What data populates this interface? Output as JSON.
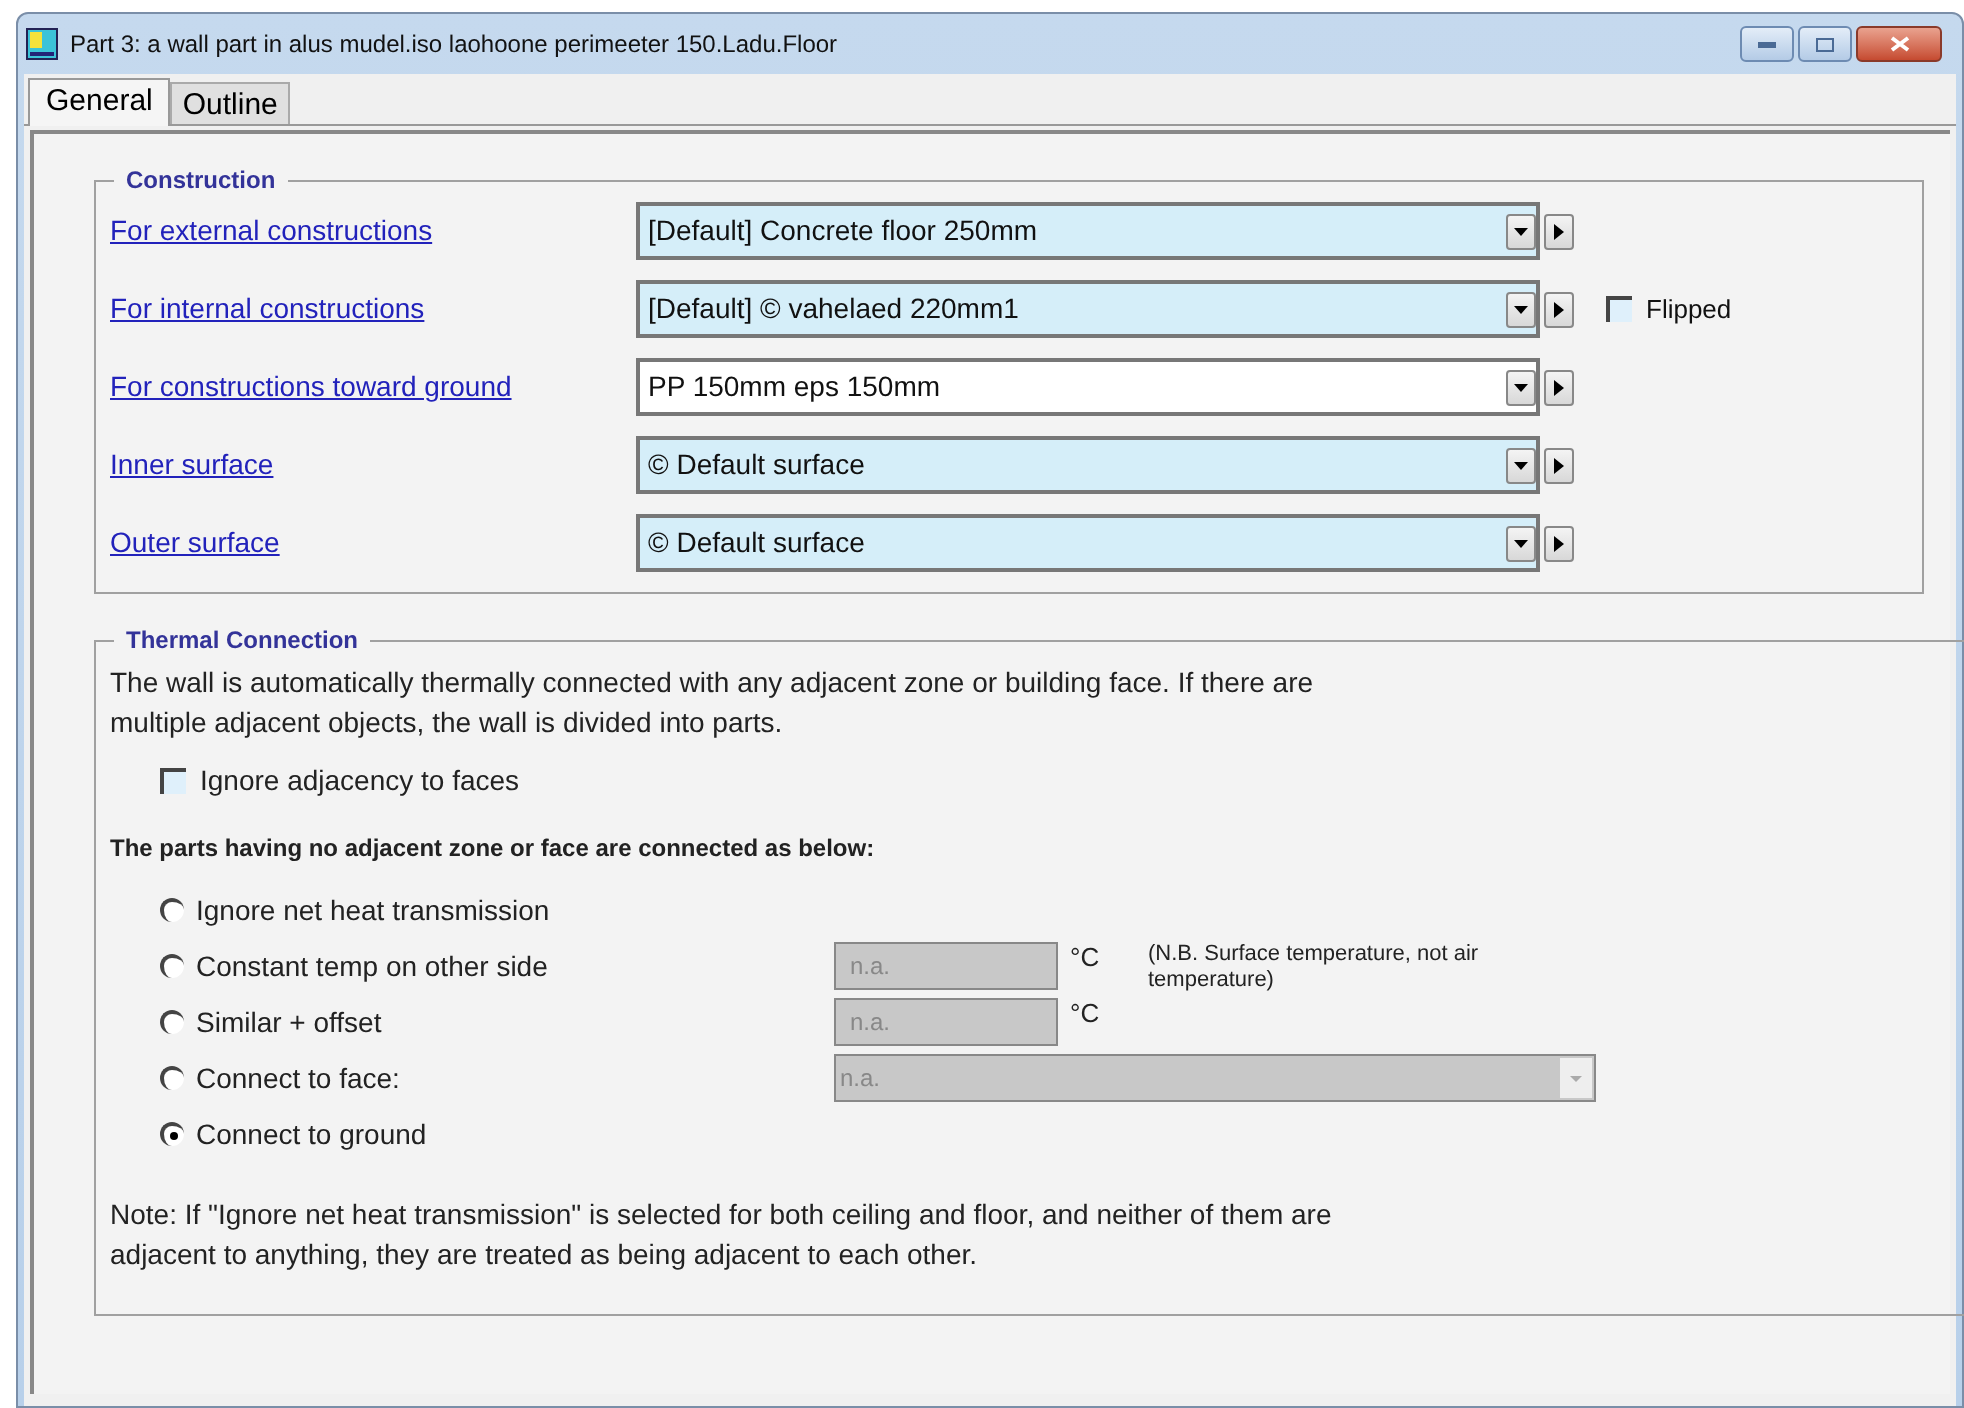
{
  "window": {
    "title": "Part 3: a wall part in alus mudel.iso laohoone perimeeter 150.Ladu.Floor"
  },
  "tabs": [
    {
      "label": "General",
      "selected": true
    },
    {
      "label": "Outline",
      "selected": false
    }
  ],
  "construction": {
    "title": "Construction",
    "rows": [
      {
        "label": "For external constructions",
        "value": "[Default] Concrete floor 250mm",
        "highlighted": true
      },
      {
        "label": "For internal constructions",
        "value": "[Default] © vahelaed 220mm1",
        "highlighted": true
      },
      {
        "label": "For constructions toward ground",
        "value": "PP 150mm eps 150mm",
        "highlighted": false
      },
      {
        "label": "Inner surface",
        "value": "© Default surface",
        "highlighted": true
      },
      {
        "label": "Outer surface",
        "value": "© Default surface",
        "highlighted": true
      }
    ],
    "flipped": {
      "label": "Flipped",
      "checked": false
    }
  },
  "thermal": {
    "title": "Thermal Connection",
    "intro": "The wall is automatically thermally connected with any adjacent zone or building face. If there are multiple adjacent objects, the wall is divided into parts.",
    "ignore_adjacency": {
      "label": "Ignore adjacency to faces",
      "checked": false
    },
    "subheading": "The parts having no adjacent zone or face are connected as below:",
    "options": [
      {
        "label": "Ignore net heat transmission",
        "selected": false,
        "kind": "plain"
      },
      {
        "label": "Constant temp on other side",
        "selected": false,
        "kind": "field",
        "value": "n.a.",
        "unit": "°C"
      },
      {
        "label": "Similar + offset",
        "selected": false,
        "kind": "field",
        "value": "n.a.",
        "unit": "°C"
      },
      {
        "label": "Connect to face:",
        "selected": false,
        "kind": "dropdown",
        "value": "n.a."
      },
      {
        "label": "Connect to ground",
        "selected": true,
        "kind": "plain"
      }
    ],
    "remark": "(N.B. Surface temperature, not air temperature)",
    "note": "Note: If \"Ignore net heat transmission\" is selected for both ceiling and floor, and neither of them are adjacent to anything, they are treated as being adjacent to each other."
  }
}
